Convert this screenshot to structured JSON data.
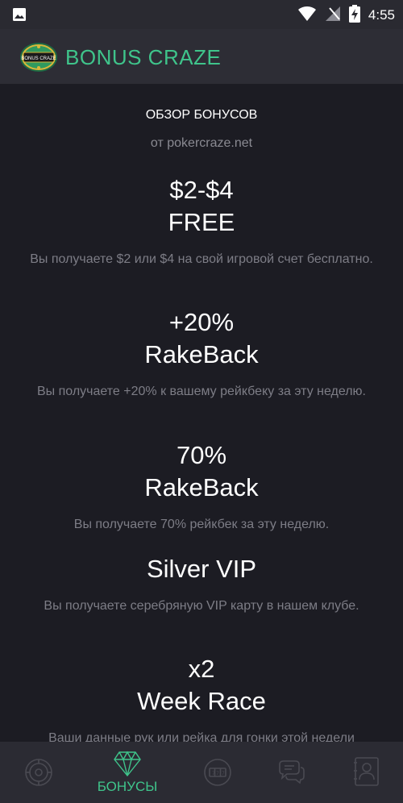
{
  "status_bar": {
    "time": "4:55",
    "icons": [
      "image-notification-icon",
      "wifi-icon",
      "no-signal-icon",
      "battery-charging-icon"
    ]
  },
  "app_bar": {
    "title": "BONUS CRAZE",
    "logo_text": "BONUS CRAZE",
    "accent_color": "#3fc48b"
  },
  "section": {
    "title": "ОБЗОР БОНУСОВ",
    "subtitle": "от pokercraze.net"
  },
  "bonuses": [
    {
      "line1": "$2-$4",
      "line2": "FREE",
      "desc": "Вы получаете $2 или $4 на свой игровой счет бесплатно."
    },
    {
      "line1": "+20%",
      "line2": "RakeBack",
      "desc": "Вы получаете +20% к вашему рейкбеку за эту неделю."
    },
    {
      "line1": "70%",
      "line2": "RakeBack",
      "desc": "Вы получаете 70% рейкбек за эту неделю."
    },
    {
      "line1": "Silver VIP",
      "line2": "",
      "desc": "Вы получаете серебряную VIP карту в нашем клубе."
    },
    {
      "line1": "x2",
      "line2": "Week Race",
      "desc": "Ваши данные рук или рейка для гонки этой недели"
    }
  ],
  "bottom_nav": {
    "active_label": "БОНУСЫ",
    "items": [
      "roulette-icon",
      "diamond-icon",
      "slot-machine-icon",
      "chat-icon",
      "contact-card-icon"
    ]
  }
}
